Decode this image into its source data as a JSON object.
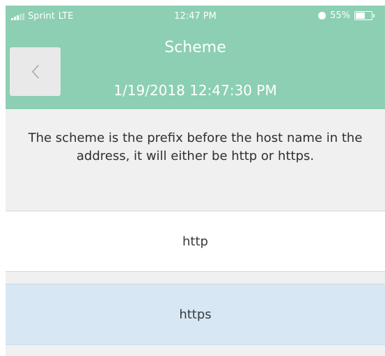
{
  "status_bar": {
    "carrier": "Sprint",
    "network": "LTE",
    "time": "12:47 PM",
    "battery": "55%",
    "battery_level": 0.55,
    "icons": [
      "signal-icon",
      "alarm-icon",
      "battery-icon"
    ]
  },
  "header": {
    "title": "Scheme",
    "timestamp": "1/19/2018  12:47:30 PM",
    "back_icon": "chevron-left-icon",
    "background_color": "#8ccfb3"
  },
  "main": {
    "description": "The scheme is the prefix before the host name in the address, it will either be http or https.",
    "options": [
      {
        "label": "http",
        "selected": false
      },
      {
        "label": "https",
        "selected": true
      }
    ],
    "selected_color": "#d8e7f4"
  }
}
